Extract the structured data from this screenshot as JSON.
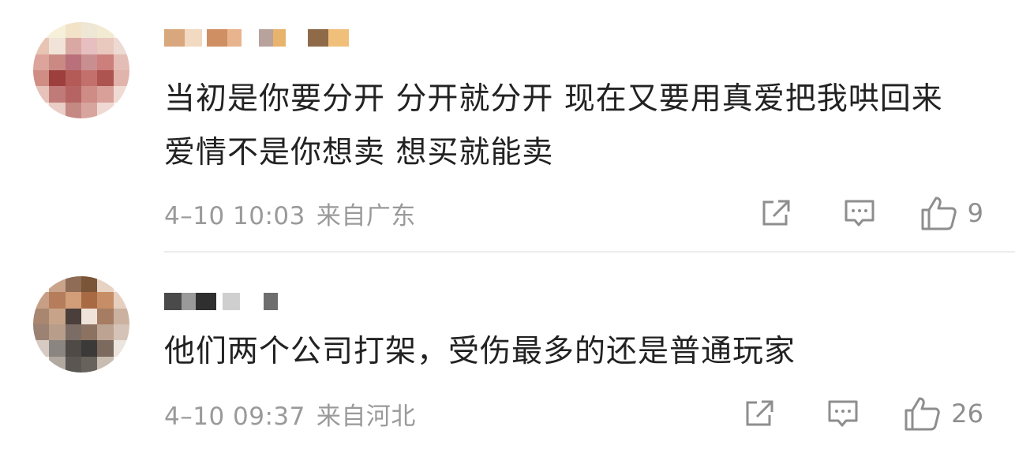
{
  "comments": [
    {
      "text": "当初是你要分开 分开就分开 现在又要用真爱把我哄回来 爱情不是你想卖 想买就能卖",
      "time": "4–10 10:03",
      "location": "来自广东",
      "likes": "9",
      "username_blur_colors": [
        "#d9a77e",
        "#f2d9c1",
        "#cf8f62",
        "#e7b48e",
        "#b7a39c",
        "#e8b36d",
        "#8f6a49",
        "#f0c07a"
      ],
      "avatar_colors": [
        "#f4f0e4",
        "#f6efd9",
        "#f2e2c8",
        "#eee7d5",
        "#f3ead3",
        "#f8f3e4",
        "#e7c4b4",
        "#f1e3d8",
        "#d9a8a3",
        "#e7bfc0",
        "#e9c8bd",
        "#eddad3",
        "#dca49a",
        "#ca8a83",
        "#b9707a",
        "#c98f90",
        "#cc7f7b",
        "#e4bdb6",
        "#cf8d84",
        "#9c3f3d",
        "#b45a57",
        "#c3706d",
        "#ad5350",
        "#e0b3ab",
        "#e6c2b9",
        "#c07b78",
        "#b66463",
        "#cf8b86",
        "#d8a099",
        "#f0dbd4",
        "#f7ede8",
        "#e9cdc6",
        "#c58983",
        "#d8a59e",
        "#f0d9d3",
        "#fbf3f0"
      ]
    },
    {
      "text": "他们两个公司打架，受伤最多的还是普通玩家",
      "time": "4–10 09:37",
      "location": "来自河北",
      "likes": "26",
      "username_blur_colors": [
        "#4a4a4a",
        "#9a9a9a",
        "#2f2f2f",
        "#cfcfcf",
        "#6e6e6e"
      ],
      "avatar_colors": [
        "#f6f1ec",
        "#caa48a",
        "#8f6c55",
        "#7a5538",
        "#e7d3c4",
        "#f7f2ee",
        "#c79f86",
        "#b57d5b",
        "#d29e7a",
        "#a86a43",
        "#c78d66",
        "#e6cfbf",
        "#a88670",
        "#c7a489",
        "#4a3f3b",
        "#efe3da",
        "#a67c62",
        "#cbb1a0",
        "#9b8272",
        "#b99d8b",
        "#7b6d66",
        "#8c7261",
        "#bda392",
        "#d5c3b7",
        "#d6cac2",
        "#8a8580",
        "#4f4a46",
        "#3b3a38",
        "#7b6a5d",
        "#ece4de",
        "#f8f5f2",
        "#b1a8a0",
        "#5a5651",
        "#68625c",
        "#c9bcb1",
        "#fbf9f7"
      ]
    }
  ]
}
